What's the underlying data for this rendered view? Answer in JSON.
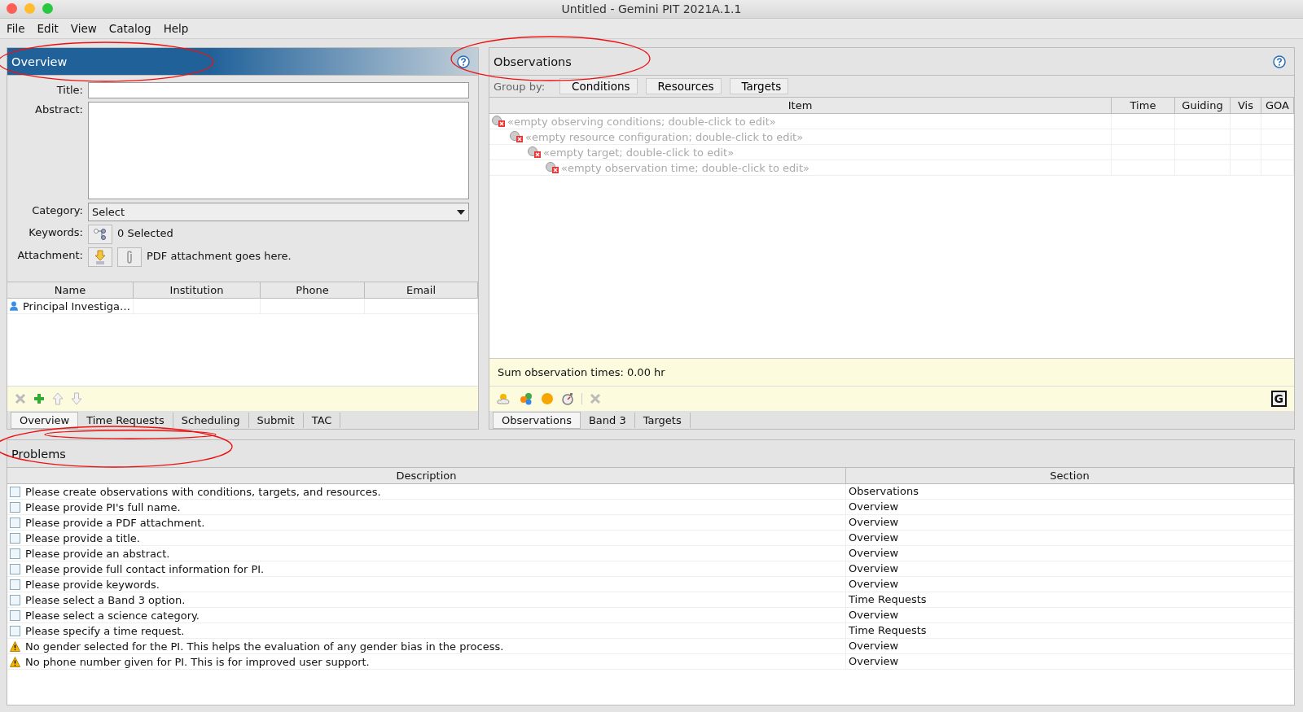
{
  "window": {
    "title": "Untitled - Gemini PIT 2021A.1.1"
  },
  "menu": [
    "File",
    "Edit",
    "View",
    "Catalog",
    "Help"
  ],
  "overview": {
    "title": "Overview",
    "title_label": "Title:",
    "abstract_label": "Abstract:",
    "category_label": "Category:",
    "category_value": "Select",
    "keywords_label": "Keywords:",
    "keywords_value": "0 Selected",
    "attachment_label": "Attachment:",
    "attachment_value": "PDF attachment goes here.",
    "investigators": {
      "columns": [
        "Name",
        "Institution",
        "Phone",
        "Email"
      ],
      "rows": [
        {
          "name": "Principal Investiga…"
        }
      ]
    }
  },
  "left_tabs": [
    {
      "label": "Overview",
      "selected": true
    },
    {
      "label": "Time Requests",
      "selected": false
    },
    {
      "label": "Scheduling",
      "selected": false
    },
    {
      "label": "Submit",
      "selected": false
    },
    {
      "label": "TAC",
      "selected": false
    }
  ],
  "observations": {
    "title": "Observations",
    "group_by_label": "Group by:",
    "group_buttons": [
      "Conditions",
      "Resources",
      "Targets"
    ],
    "columns": [
      "Item",
      "Time",
      "Guiding",
      "Vis",
      "GOA"
    ],
    "tree": [
      {
        "label": "«empty observing conditions; double-click to edit»",
        "children": [
          {
            "label": "«empty resource configuration; double-click to edit»",
            "children": [
              {
                "label": "«empty target; double-click to edit»",
                "children": [
                  {
                    "label": "«empty observation time; double-click to edit»"
                  }
                ]
              }
            ]
          }
        ]
      }
    ],
    "sum": "Sum observation times: 0.00 hr",
    "toolbar_key": "G"
  },
  "right_tabs": [
    {
      "label": "Observations",
      "selected": true
    },
    {
      "label": "Band 3",
      "selected": false
    },
    {
      "label": "Targets",
      "selected": false
    }
  ],
  "problems": {
    "title": "Problems",
    "columns": [
      "Description",
      "Section"
    ],
    "rows": [
      {
        "kind": "task",
        "description": "Please create observations with conditions, targets, and resources.",
        "section": "Observations"
      },
      {
        "kind": "task",
        "description": "Please provide PI's full name.",
        "section": "Overview"
      },
      {
        "kind": "task",
        "description": "Please provide a PDF attachment.",
        "section": "Overview"
      },
      {
        "kind": "task",
        "description": "Please provide a title.",
        "section": "Overview"
      },
      {
        "kind": "task",
        "description": "Please provide an abstract.",
        "section": "Overview"
      },
      {
        "kind": "task",
        "description": "Please provide full contact information for PI.",
        "section": "Overview"
      },
      {
        "kind": "task",
        "description": "Please provide keywords.",
        "section": "Overview"
      },
      {
        "kind": "task",
        "description": "Please select a Band 3 option.",
        "section": "Time Requests"
      },
      {
        "kind": "task",
        "description": "Please select a science category.",
        "section": "Overview"
      },
      {
        "kind": "task",
        "description": "Please specify a time request.",
        "section": "Time Requests"
      },
      {
        "kind": "warning",
        "description": "No gender selected for the PI. This helps the evaluation of any gender bias in the process.",
        "section": "Overview"
      },
      {
        "kind": "warning",
        "description": "No phone number given for PI. This is for improved user support.",
        "section": "Overview"
      }
    ]
  }
}
